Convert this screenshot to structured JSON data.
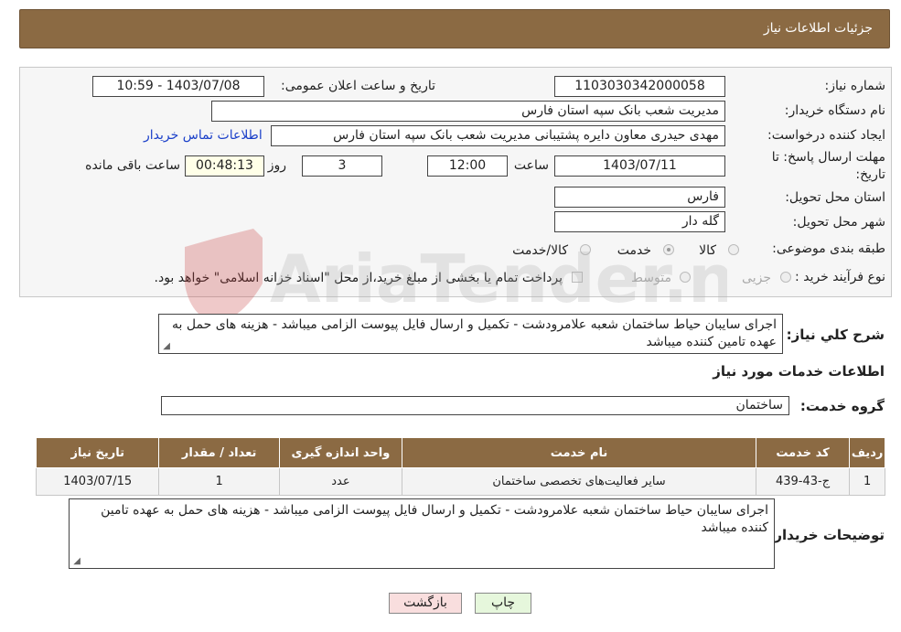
{
  "header": {
    "title": "جزئیات اطلاعات نیاز"
  },
  "fields": {
    "need_number_label": "شماره نیاز:",
    "need_number": "1103030342000058",
    "announce_label": "تاریخ و ساعت اعلان عمومی:",
    "announce_value": "1403/07/08 - 10:59",
    "buyer_org_label": "نام دستگاه خریدار:",
    "buyer_org": "مدیریت شعب بانک سپه استان فارس",
    "creator_label": "ایجاد کننده درخواست:",
    "creator": "مهدی حیدری معاون دایره پشتیبانی مدیریت شعب بانک سپه استان فارس",
    "contact_link": "اطلاعات تماس خریدار",
    "deadline_label_line1": "مهلت ارسال پاسخ: تا",
    "deadline_label_line2": "تاریخ:",
    "deadline_date": "1403/07/11",
    "time_label": "ساعت",
    "deadline_time": "12:00",
    "days_value": "3",
    "days_label": "روز و",
    "remaining_value": "00:48:13",
    "remaining_label": "ساعت باقی مانده",
    "province_label": "استان محل تحویل:",
    "province": "فارس",
    "city_label": "شهر محل تحویل:",
    "city": "گله دار",
    "category_label": "طبقه بندی موضوعی:",
    "category_options": [
      {
        "label": "کالا",
        "checked": false
      },
      {
        "label": "خدمت",
        "checked": true
      },
      {
        "label": "کالا/خدمت",
        "checked": false
      }
    ],
    "process_label": "نوع فرآیند خرید :",
    "process_options": [
      {
        "label": "جزیی",
        "checked": false
      },
      {
        "label": "متوسط",
        "checked": false
      }
    ],
    "payment_note": "پرداخت تمام یا بخشی از مبلغ خرید،از محل \"اسناد خزانه اسلامی\" خواهد بود."
  },
  "summary": {
    "label": "شرح کلي نياز:",
    "text": "اجرای سایبان حیاط ساختمان شعبه علامرودشت - تکمیل و ارسال فایل پیوست الزامی میباشد - هزینه های حمل به عهده تامین کننده میباشد"
  },
  "services": {
    "section_title": "اطلاعات خدمات مورد نياز",
    "group_label": "گروه خدمت:",
    "group_value": "ساختمان",
    "columns": [
      "ردیف",
      "کد خدمت",
      "نام خدمت",
      "واحد اندازه گیری",
      "تعداد / مقدار",
      "تاریخ نیاز"
    ],
    "rows": [
      [
        "1",
        "ج-43-439",
        "سایر فعالیت‌های تخصصی ساختمان",
        "عدد",
        "1",
        "1403/07/15"
      ]
    ]
  },
  "buyer_notes": {
    "label": "توضیحات خریدار:",
    "text": "اجرای سایبان حیاط ساختمان شعبه علامرودشت - تکمیل و ارسال فایل پیوست الزامی میباشد - هزینه های حمل به عهده تامین کننده میباشد"
  },
  "buttons": {
    "print": "چاپ",
    "back": "بازگشت"
  },
  "watermark": {
    "text": "AriaTender.net"
  },
  "colors": {
    "header": "#8b6a43",
    "link": "#1a3fc9",
    "back_button": "#f9dede",
    "print_button": "#e6f7dc"
  }
}
